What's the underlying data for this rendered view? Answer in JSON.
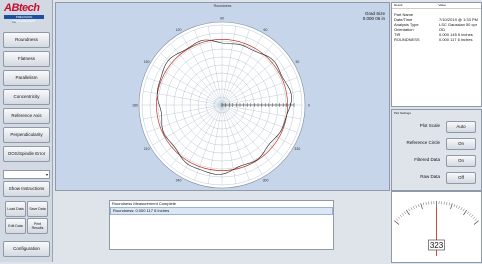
{
  "logo": {
    "name": "ABtech",
    "bar_text": "PRECISION MEASUREMENT",
    "tagline": "Inc"
  },
  "nav": [
    {
      "id": "roundness",
      "label": "Roundness"
    },
    {
      "id": "flatness",
      "label": "Flatness"
    },
    {
      "id": "parallelism",
      "label": "Parallelism"
    },
    {
      "id": "concentricity",
      "label": "Concentricity"
    },
    {
      "id": "reference-axis",
      "label": "Reference Axis"
    },
    {
      "id": "perpendicularity",
      "label": "Perpendicularity"
    },
    {
      "id": "oos-spindle-error",
      "label": "OOS/Spindle Error"
    }
  ],
  "show_instructions": "Show Instructions",
  "small_buttons": [
    {
      "id": "load-data",
      "label": "Load Data"
    },
    {
      "id": "save-data",
      "label": "Save Data"
    },
    {
      "id": "edit-data",
      "label": "Edit Data"
    },
    {
      "id": "print-results",
      "label": "Print Results"
    }
  ],
  "configuration": "Configuration",
  "plot": {
    "title": "Roundness",
    "grid_size_label": "Grad Size",
    "grid_size_value": "0.000 06 in",
    "angle_labels": [
      "0",
      "30",
      "60",
      "90",
      "120",
      "150",
      "180",
      "210",
      "240",
      "270",
      "300",
      "330"
    ],
    "colors": {
      "bg": "#c6d5ea",
      "ring": "#a7b7c9",
      "reference": "#c0392b",
      "profile": "#222222"
    }
  },
  "results": {
    "lines": [
      "Roundness Measurement Complete",
      "Roundness: 0.000 117 6 Inches"
    ]
  },
  "info": {
    "headers": [
      "Result",
      "Value"
    ],
    "rows": [
      {
        "k": "Part Name",
        "v": ""
      },
      {
        "k": "Date/Time",
        "v": "7/10/2019 @ 1:33 PM"
      },
      {
        "k": "Analysis Type",
        "v": "LSC Gaussian 50 cpr"
      },
      {
        "k": "Orientation",
        "v": "OD"
      },
      {
        "k": "TIR",
        "v": "0.000 145 5 inches"
      },
      {
        "k": "ROUNDNESS",
        "v": "0.000 117 6 inches"
      }
    ]
  },
  "settings": {
    "title": "Plot Settings",
    "rows": [
      {
        "label": "Plot Scale",
        "value": "Auto"
      },
      {
        "label": "Reference Circle",
        "value": "On"
      },
      {
        "label": "Filtered Data",
        "value": "On"
      },
      {
        "label": "Raw Data",
        "value": "Off"
      }
    ]
  },
  "gauge": {
    "value": "323",
    "min": 0,
    "max": 360
  }
}
